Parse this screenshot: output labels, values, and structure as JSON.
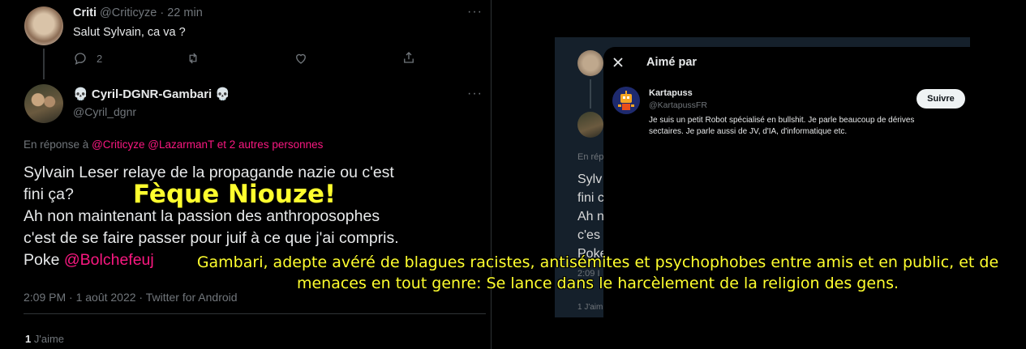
{
  "tweet1": {
    "name": "Criti",
    "handle": "@Criticyze",
    "time": "· 22 min",
    "text": "Salut Sylvain, ca va ?",
    "reply_count": "2"
  },
  "tweet2": {
    "skull_left": "💀",
    "name": "Cyril-DGNR-Gambari",
    "skull_right": "💀",
    "handle": "@Cyril_dgnr",
    "reply_prefix": "En réponse à",
    "reply_mentions": "@Criticyze @LazarmanT  et 2 autres personnes",
    "text_main": "Sylvain Leser relaye de la propagande nazie ou c'est\nfini ça?\nAh non maintenant la passion des anthroposophes\nc'est de se faire passer pour juif à ce que j'ai compris.\nPoke ",
    "text_mention": "@Bolchefeuj",
    "timestamp": "2:09 PM · 1 août 2022 · Twitter for Android",
    "likes_count": "1",
    "likes_label": "J'aime"
  },
  "background_panel": {
    "reply_prefix": "En rép",
    "text_lines": [
      "Sylv",
      "fini c",
      "Ah n",
      "c'es",
      "Poke",
      "2:09 I",
      "1 J'aim"
    ]
  },
  "modal": {
    "title": "Aimé par",
    "user_name": "Kartapuss",
    "user_handle": "@KartapussFR",
    "follow_label": "Suivre",
    "bio": "Je suis un petit Robot spécialisé en bullshit. Je parle beaucoup de dérives sectaires. Je parle aussi de JV, d'IA, d'informatique etc."
  },
  "overlay": {
    "caption": "Fèque Niouze!",
    "commentary": "Gambari, adepte avéré de blagues racistes, antisémites et psychophobes entre amis et en public, et de menaces en tout genre: Se lance dans le harcèlement de la religion des gens."
  },
  "colors": {
    "background": "#000000",
    "text": "#e7e9ea",
    "muted": "#71767b",
    "mention": "#f91880",
    "overlay": "#ffff2e",
    "panel": "#15202b"
  }
}
